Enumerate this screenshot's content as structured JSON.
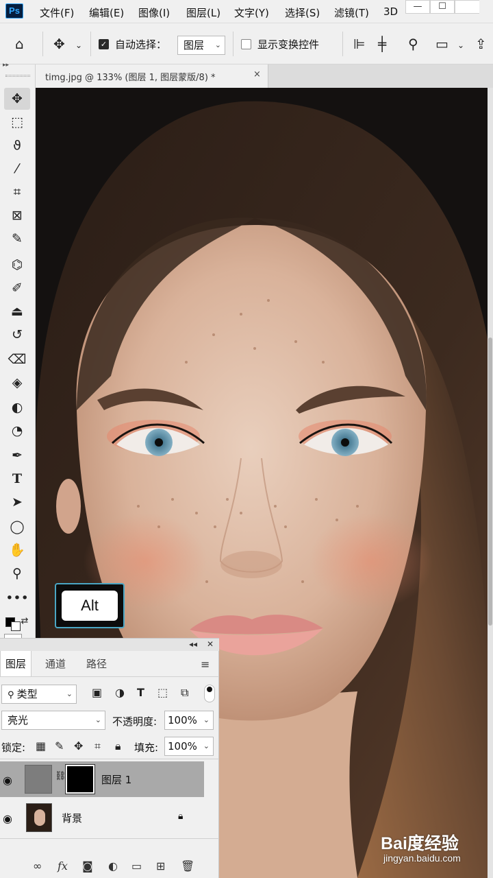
{
  "app": {
    "logo_text": "Ps",
    "menus": [
      "文件(F)",
      "编辑(E)",
      "图像(I)",
      "图层(L)",
      "文字(Y)",
      "选择(S)",
      "滤镜(T)",
      "3D"
    ],
    "window_controls": [
      "minimize",
      "maximize"
    ]
  },
  "options_bar": {
    "auto_select_checked": true,
    "auto_select_label": "自动选择：",
    "auto_select_target": "图层",
    "show_transform_checked": false,
    "show_transform_label": "显示变换控件"
  },
  "document": {
    "tab_title": "timg.jpg @ 133% (图层 1, 图层蒙版/8) *",
    "close_glyph": "×"
  },
  "toolbox": {
    "tools": [
      "move-tool",
      "rectangular-marquee-tool",
      "lasso-tool",
      "magic-wand-tool",
      "crop-tool",
      "frame-tool",
      "eyedropper-tool",
      "spot-healing-tool",
      "brush-tool",
      "clone-stamp-tool",
      "history-brush-tool",
      "eraser-tool",
      "paint-bucket-tool",
      "blur-tool",
      "dodge-tool",
      "pen-tool",
      "type-tool",
      "path-selection-tool",
      "ellipse-tool",
      "hand-tool",
      "zoom-tool",
      "more-tools"
    ],
    "active_tool": "move-tool"
  },
  "key_overlay": {
    "key": "Alt"
  },
  "layers_panel": {
    "tabs": [
      "图层",
      "通道",
      "路径"
    ],
    "active_tab": "图层",
    "filter_kind": "类型",
    "blend_mode": "亮光",
    "opacity_label": "不透明度:",
    "opacity_value": "100%",
    "lock_label": "锁定:",
    "fill_label": "填充:",
    "fill_value": "100%",
    "layers": [
      {
        "name": "图层 1",
        "visible": true,
        "selected": true,
        "has_mask": true,
        "mask_color": "#000000",
        "thumb_color": "#808080"
      },
      {
        "name": "背景",
        "visible": true,
        "selected": false,
        "locked": true
      }
    ],
    "bottom_actions": [
      "link-layers",
      "layer-style",
      "add-mask",
      "adjustment-layer",
      "new-group",
      "new-layer",
      "delete-layer"
    ]
  },
  "watermark": {
    "main": "Bai度经验",
    "sub": "jingyan.baidu.com"
  },
  "colors": {
    "chrome_bg": "#f0f0f0",
    "selected_layer": "#a9a9a9",
    "ps_logo_bg": "#061e3e",
    "ps_logo_fg": "#31a8ff",
    "overlay_border": "#4aa6c4"
  }
}
